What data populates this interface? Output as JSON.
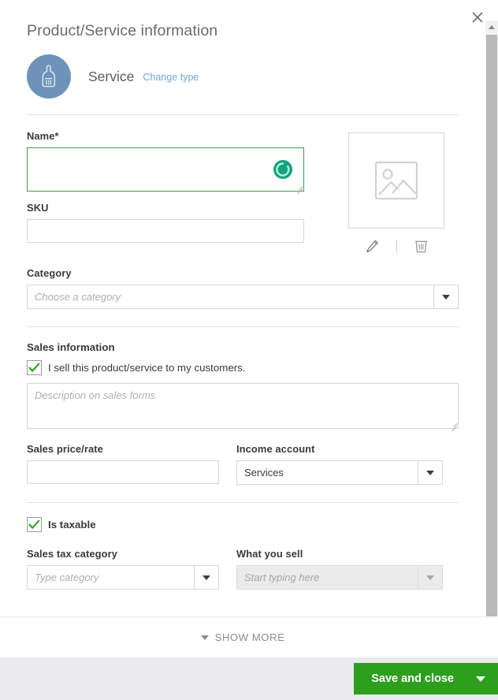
{
  "dialog": {
    "title": "Product/Service information",
    "close_label": "Close",
    "close_icon": "close-icon"
  },
  "type_row": {
    "icon": "service-bell-icon",
    "type_name": "Service",
    "change_type_link": "Change type",
    "avatar_color": "#6f93b8"
  },
  "name_field": {
    "label": "Name*",
    "value": "",
    "placeholder": "",
    "state": "focused",
    "border_color": "#3f9c51",
    "spinner_icon": "loading-spinner-icon",
    "spinner_color": "#0fa47f"
  },
  "sku_field": {
    "label": "SKU",
    "value": "",
    "placeholder": ""
  },
  "image": {
    "placeholder_icon": "image-placeholder-icon",
    "edit_icon": "pencil-icon",
    "delete_icon": "trash-icon"
  },
  "category_field": {
    "label": "Category",
    "value": "",
    "placeholder": "Choose a category",
    "caret_icon": "chevron-down-icon"
  },
  "sales_section": {
    "title": "Sales information",
    "checkbox_label": "I sell this product/service to my customers.",
    "checkbox_checked": true,
    "check_color": "#2ca01c",
    "description_value": "",
    "description_placeholder": "Description on sales forms"
  },
  "sales_price": {
    "label": "Sales price/rate",
    "value": "",
    "placeholder": ""
  },
  "income_account": {
    "label": "Income account",
    "value": "Services",
    "placeholder": "",
    "caret_icon": "chevron-down-icon"
  },
  "tax_section": {
    "checkbox_label": "Is taxable",
    "checkbox_checked": true
  },
  "sales_tax_category": {
    "label": "Sales tax category",
    "value": "",
    "placeholder": "Type category",
    "caret_icon": "chevron-down-icon"
  },
  "what_you_sell": {
    "label": "What you sell",
    "value": "",
    "placeholder": "Start typing here",
    "disabled": true,
    "caret_icon": "chevron-down-icon"
  },
  "show_more": {
    "label": "SHOW MORE",
    "caret_icon": "chevron-down-icon"
  },
  "footer": {
    "save_label": "Save and close",
    "save_caret_icon": "chevron-down-icon",
    "save_color": "#2ca01c"
  },
  "scrollbar": {
    "up_arrow_icon": "arrow-up-icon",
    "orientation": "vertical"
  }
}
